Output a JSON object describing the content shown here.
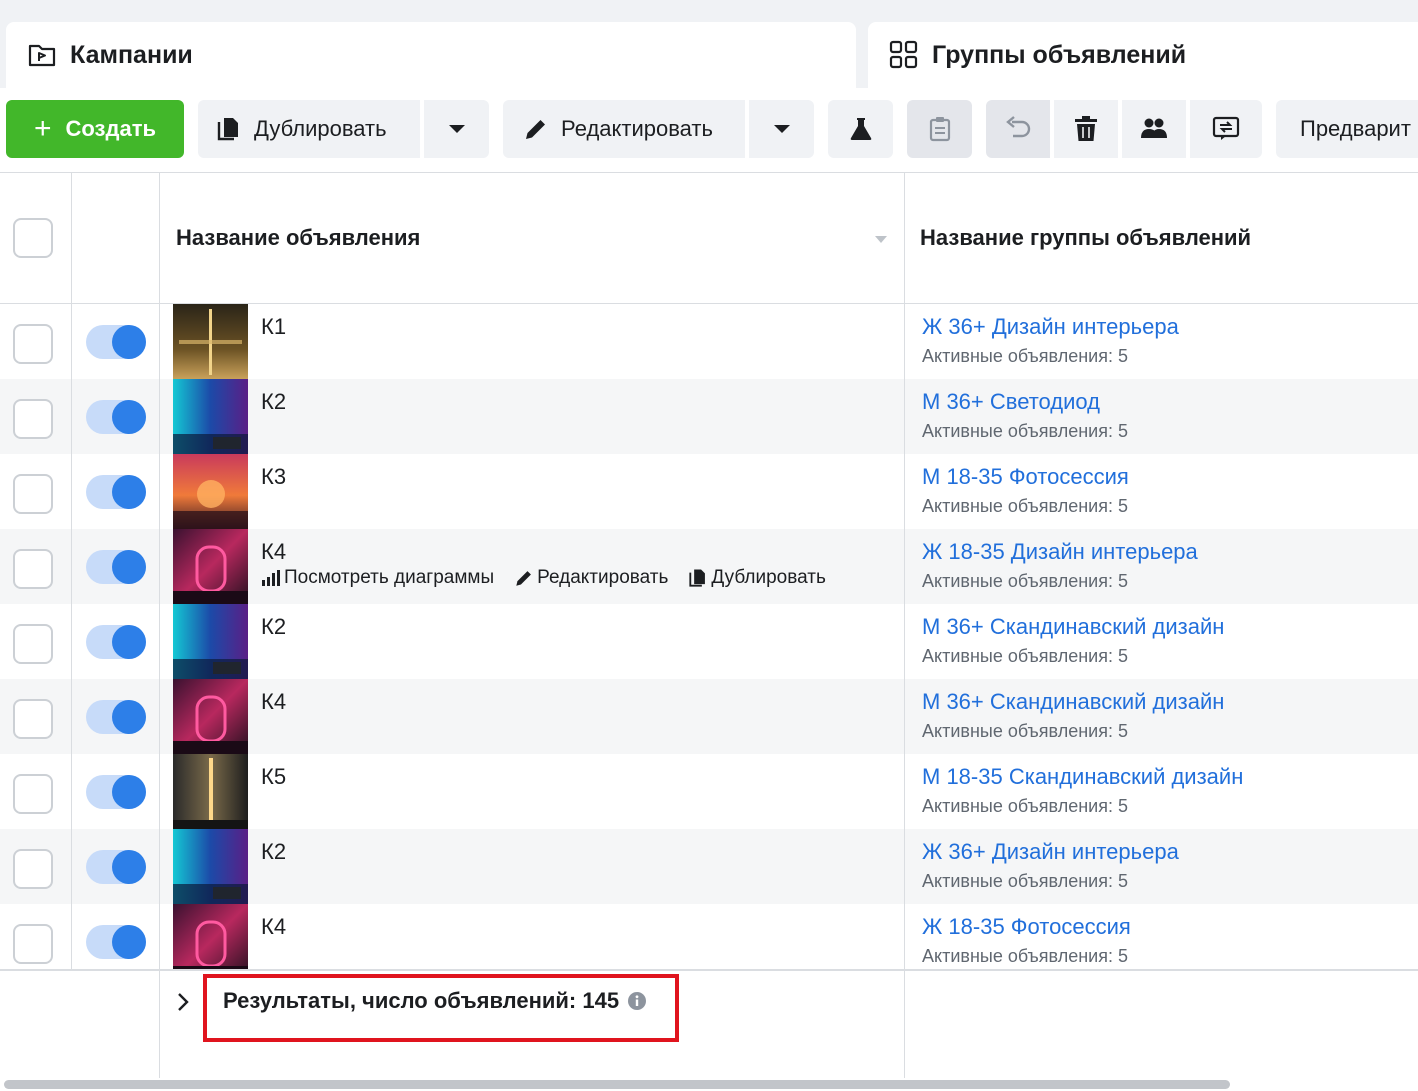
{
  "tabs": {
    "campaigns": {
      "label": "Кампании",
      "icon": "folder-flag-icon"
    },
    "adsets": {
      "label": "Группы объявлений",
      "icon": "grid-icon"
    }
  },
  "toolbar": {
    "create_label": "Создать",
    "duplicate_label": "Дублировать",
    "edit_label": "Редактировать",
    "preview_label": "Предварит",
    "create_color": "#42b72a"
  },
  "table": {
    "col_ad_name": "Название объявления",
    "col_adset_name": "Название группы объявлений",
    "row_actions": {
      "charts": "Посмотреть диаграммы",
      "edit": "Редактировать",
      "duplicate": "Дублировать"
    },
    "rows": [
      {
        "ad": "К1",
        "adset": "Ж 36+ Дизайн интерьера",
        "sub": "Активные объявления: 5",
        "active": true,
        "thumb": "thumb-gold-text"
      },
      {
        "ad": "К2",
        "adset": "М 36+ Светодиод",
        "sub": "Активные объявления: 5",
        "active": true,
        "thumb": "thumb-teal-purple"
      },
      {
        "ad": "К3",
        "adset": "М 18-35 Фотосессия",
        "sub": "Активные объявления: 5",
        "active": true,
        "thumb": "thumb-sunset"
      },
      {
        "ad": "К4",
        "adset": "Ж 18-35 Дизайн интерьера",
        "sub": "Активные объявления: 5",
        "active": true,
        "thumb": "thumb-pink-neon",
        "hover": true
      },
      {
        "ad": "К2",
        "adset": "М 36+ Скандинавский дизайн",
        "sub": "Активные объявления: 5",
        "active": true,
        "thumb": "thumb-teal-purple"
      },
      {
        "ad": "К4",
        "adset": "М 36+ Скандинавский дизайн",
        "sub": "Активные объявления: 5",
        "active": true,
        "thumb": "thumb-pink-neon"
      },
      {
        "ad": "К5",
        "adset": "М 18-35 Скандинавский дизайн",
        "sub": "Активные объявления: 5",
        "active": true,
        "thumb": "thumb-dark-lamp"
      },
      {
        "ad": "К2",
        "adset": "Ж 36+ Дизайн интерьера",
        "sub": "Активные объявления: 5",
        "active": true,
        "thumb": "thumb-teal-purple"
      },
      {
        "ad": "К4",
        "adset": "Ж 18-35 Фотосессия",
        "sub": "Активные объявления: 5",
        "active": true,
        "thumb": "thumb-pink-neon"
      }
    ]
  },
  "footer": {
    "results_label": "Результаты, число объявлений: 145",
    "highlight_color": "#e0141e"
  },
  "colors": {
    "link": "#216fdb",
    "toggle_on": "#2d7fe8",
    "toggle_track": "#c7dbf9"
  }
}
